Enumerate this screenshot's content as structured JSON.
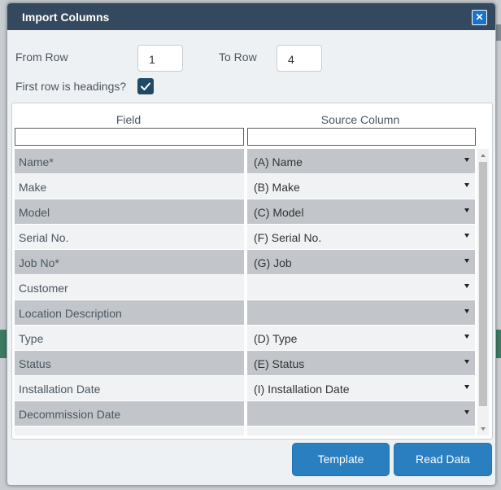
{
  "dialog": {
    "title": "Import Columns",
    "close_glyph": "✕"
  },
  "range": {
    "from_label": "From Row",
    "from_value": "1",
    "to_label": "To Row",
    "to_value": "4",
    "headings_label": "First row is headings?",
    "headings_checked": true
  },
  "grid": {
    "field_header": "Field",
    "source_header": "Source Column",
    "rows": [
      {
        "field": "Name*",
        "source": "(A) Name"
      },
      {
        "field": "Make",
        "source": "(B) Make"
      },
      {
        "field": "Model",
        "source": "(C) Model"
      },
      {
        "field": "Serial No.",
        "source": "(F) Serial No."
      },
      {
        "field": "Job No*",
        "source": "(G) Job"
      },
      {
        "field": "Customer",
        "source": ""
      },
      {
        "field": "Location Description",
        "source": ""
      },
      {
        "field": "Type",
        "source": "(D) Type"
      },
      {
        "field": "Status",
        "source": "(E) Status"
      },
      {
        "field": "Installation Date",
        "source": "(I) Installation Date"
      },
      {
        "field": "Decommission Date",
        "source": ""
      },
      {
        "field": "",
        "source": ""
      }
    ]
  },
  "buttons": {
    "template": "Template",
    "read_data": "Read Data"
  },
  "colors": {
    "title_bar": "#34495e",
    "button": "#2a7fc0",
    "row_dark": "#c2c6ca",
    "row_light": "#f0f2f4"
  }
}
